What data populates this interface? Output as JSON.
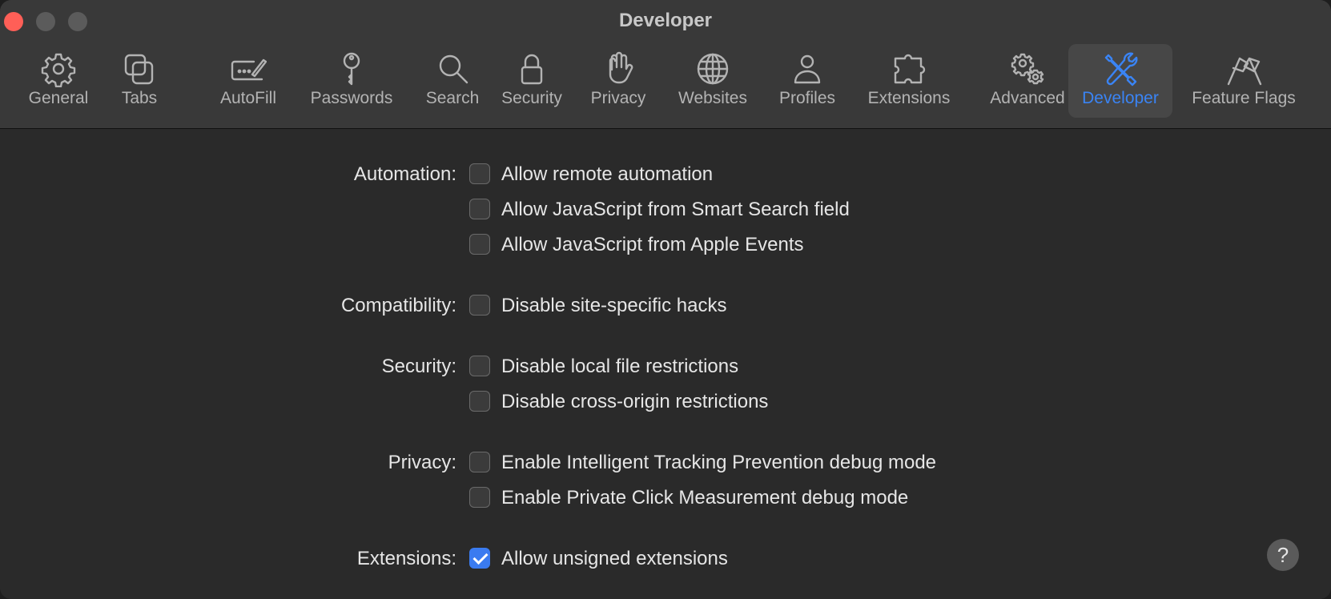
{
  "window": {
    "title": "Developer"
  },
  "tabs": [
    {
      "label": "General",
      "icon": "gear-icon"
    },
    {
      "label": "Tabs",
      "icon": "tabs-icon"
    },
    {
      "label": "AutoFill",
      "icon": "autofill-icon"
    },
    {
      "label": "Passwords",
      "icon": "key-icon"
    },
    {
      "label": "Search",
      "icon": "search-icon"
    },
    {
      "label": "Security",
      "icon": "lock-icon"
    },
    {
      "label": "Privacy",
      "icon": "hand-icon"
    },
    {
      "label": "Websites",
      "icon": "globe-icon"
    },
    {
      "label": "Profiles",
      "icon": "person-icon"
    },
    {
      "label": "Extensions",
      "icon": "puzzle-icon"
    },
    {
      "label": "Advanced",
      "icon": "gears-icon"
    },
    {
      "label": "Developer",
      "icon": "wrench-screwdriver-icon",
      "selected": true
    },
    {
      "label": "Feature Flags",
      "icon": "flags-icon"
    }
  ],
  "sections": {
    "automation": {
      "label": "Automation:",
      "options": [
        {
          "label": "Allow remote automation",
          "checked": false
        },
        {
          "label": "Allow JavaScript from Smart Search field",
          "checked": false
        },
        {
          "label": "Allow JavaScript from Apple Events",
          "checked": false
        }
      ]
    },
    "compatibility": {
      "label": "Compatibility:",
      "options": [
        {
          "label": "Disable site-specific hacks",
          "checked": false
        }
      ]
    },
    "security": {
      "label": "Security:",
      "options": [
        {
          "label": "Disable local file restrictions",
          "checked": false
        },
        {
          "label": "Disable cross-origin restrictions",
          "checked": false
        }
      ]
    },
    "privacy": {
      "label": "Privacy:",
      "options": [
        {
          "label": "Enable Intelligent Tracking Prevention debug mode",
          "checked": false
        },
        {
          "label": "Enable Private Click Measurement debug mode",
          "checked": false
        }
      ]
    },
    "extensions": {
      "label": "Extensions:",
      "options": [
        {
          "label": "Allow unsigned extensions",
          "checked": true
        }
      ]
    }
  },
  "help": {
    "label": "?"
  },
  "colors": {
    "accent": "#3a84f5",
    "checkbox_checked": "#3a7bf0",
    "close": "#ff5f57"
  }
}
